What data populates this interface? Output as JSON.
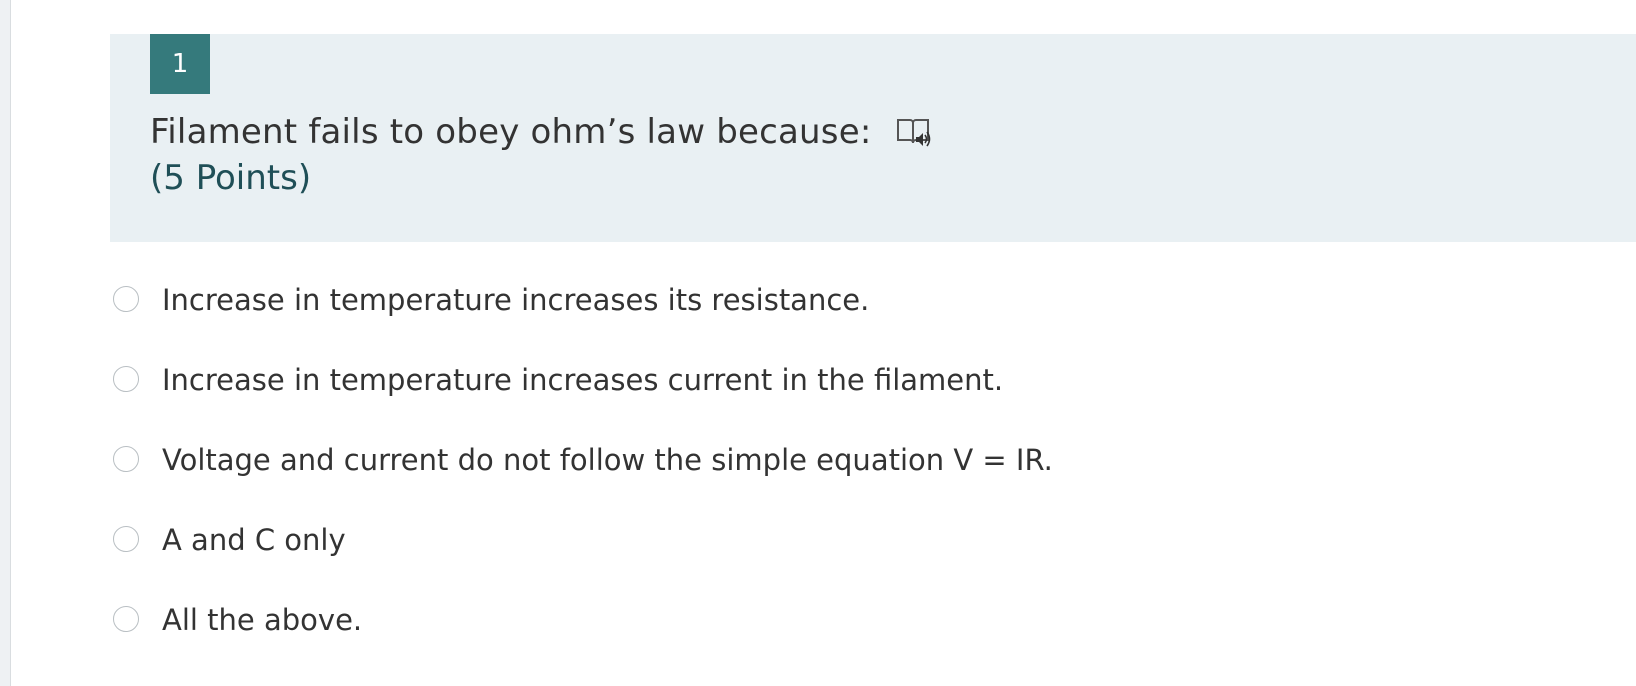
{
  "question": {
    "number": "1",
    "title": "Filament fails to obey ohm’s law because:",
    "points": "(5 Points)",
    "reader_icon": "immersive-reader-icon"
  },
  "options": [
    {
      "label": "Increase in temperature increases its resistance.",
      "selected": false
    },
    {
      "label": "Increase in temperature increases current in the filament.",
      "selected": false
    },
    {
      "label": "Voltage and current do not follow the simple equation V = IR.",
      "selected": false
    },
    {
      "label": "A and C only",
      "selected": false
    },
    {
      "label": "All the above.",
      "selected": false
    }
  ],
  "colors": {
    "number_badge": "#357a7c",
    "card_background": "#e9f0f3",
    "points_text": "#1f4f57"
  }
}
